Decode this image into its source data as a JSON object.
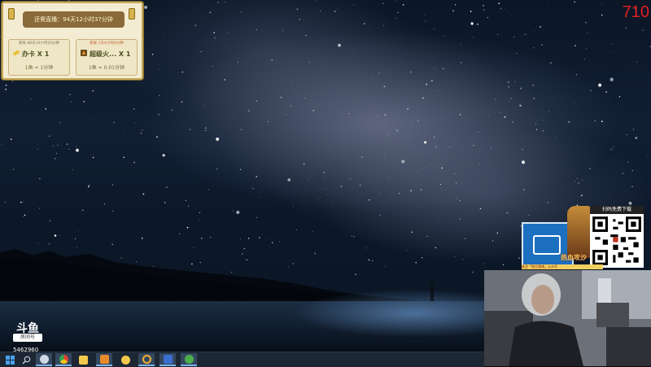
{
  "gift_panel": {
    "title": "还需直播：94天12小时37分钟",
    "cards": [
      {
        "top_text": "距离 88天16小时20分钟",
        "item_name": "办卡 X 1",
        "rate": "1鱼 ≈ 1分钟",
        "icon": "gold-card-icon"
      },
      {
        "top_text": "距离 1天4小时6分钟",
        "item_name": "超级火... X 1",
        "rate": "1鱼 ≈ 0.01分钟",
        "icon": "rocket-icon"
      }
    ]
  },
  "overlay_counter": "710",
  "qr_ad": {
    "label": "扫码免费下载",
    "game_title": "热血攻沙",
    "strip_text": "关注「地方游戏」公众号"
  },
  "logo": {
    "brand": "斗鱼",
    "tag": "房间号",
    "room_number": "5462960"
  },
  "taskbar": {
    "items": [
      {
        "name": "windows-start-icon",
        "color": "#4aa3f0"
      },
      {
        "name": "search-icon",
        "color": "#c8d0da"
      },
      {
        "name": "steam-icon",
        "color": "#cfd8e3"
      },
      {
        "name": "chrome-icon",
        "color": "#f0c020"
      },
      {
        "name": "browser-icon",
        "color": "#2a7fd8"
      },
      {
        "name": "game-client-icon",
        "color": "#e88a2a"
      },
      {
        "name": "tencent-icon",
        "color": "#f2c94c"
      },
      {
        "name": "orange-circle-icon",
        "color": "#f0b030"
      },
      {
        "name": "obs-icon",
        "color": "#3a6ed0"
      },
      {
        "name": "green-app-icon",
        "color": "#4cae4c"
      }
    ]
  }
}
